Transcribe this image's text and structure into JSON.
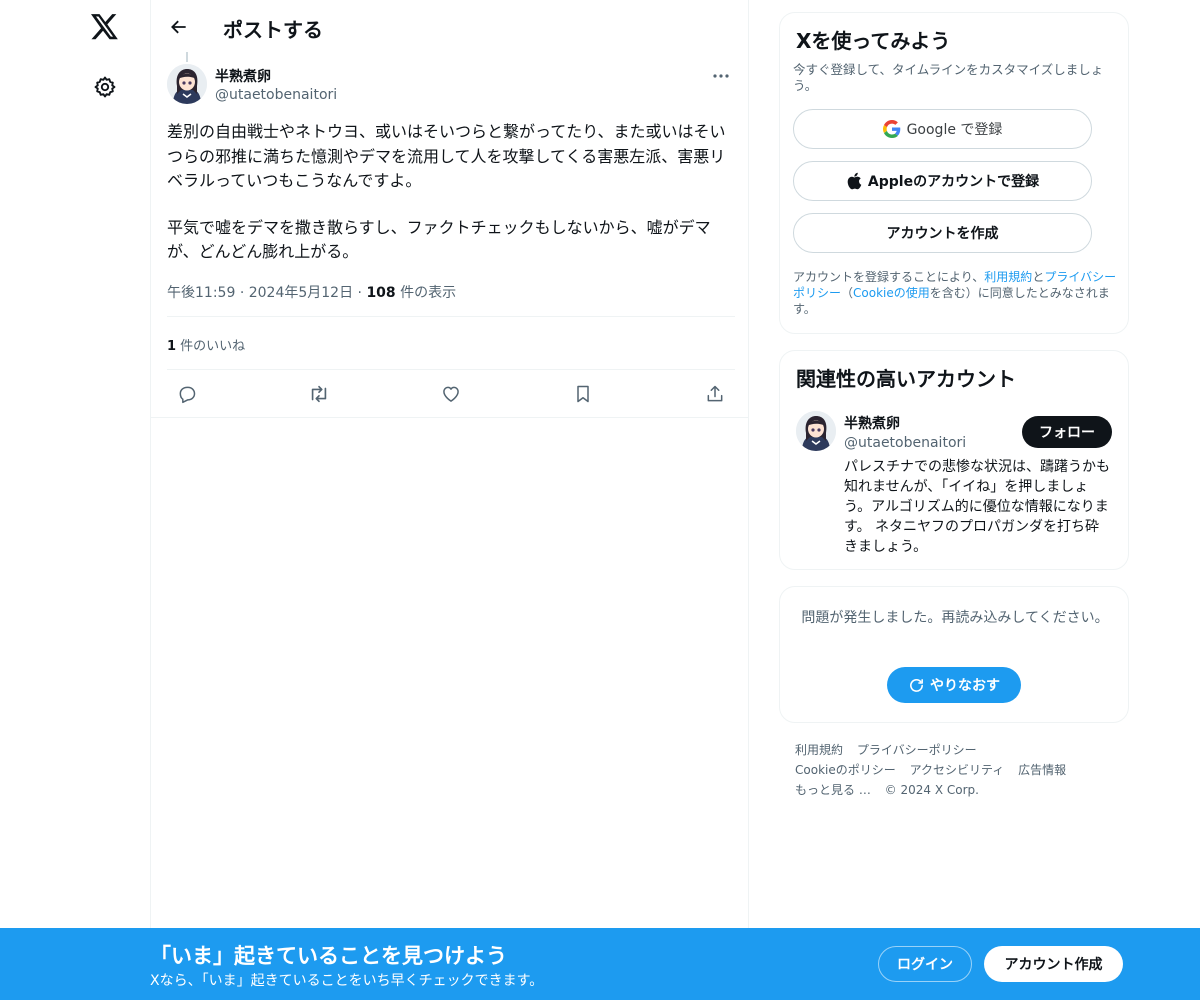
{
  "nav": {
    "logo_icon": "x-logo-icon",
    "settings_icon": "gear-icon"
  },
  "header": {
    "back_icon": "arrow-left-icon",
    "title": "ポストする"
  },
  "post": {
    "author_name": "半熟煮卵",
    "author_handle": "@utaetobenaitori",
    "paragraph1": "差別の自由戦士やネトウヨ、或いはそいつらと繋がってたり、また或いはそいつらの邪推に満ちた憶測やデマを流用して人を攻撃してくる害悪左派、害悪リベラルっていつもこうなんですよ。",
    "paragraph2": "平気で嘘をデマを撒き散らすし、ファクトチェックもしないから、嘘がデマが、どんどん膨れ上がる。",
    "time": "午後11:59",
    "sep": "·",
    "date": "2024年5月12日",
    "views_count": "108",
    "views_label": " 件の表示",
    "likes_count": "1",
    "likes_label": " 件のいいね"
  },
  "signup": {
    "title": "Xを使ってみよう",
    "subtitle": "今すぐ登録して、タイムラインをカスタマイズしましょう。",
    "google_label": "Google で登録",
    "apple_label": "Appleのアカウントで登録",
    "create_label": "アカウントを作成",
    "terms_prefix": "アカウントを登録することにより、",
    "terms_link": "利用規約",
    "terms_and": "と",
    "privacy_link": "プライバシーポリシー",
    "terms_paren_open": "（",
    "cookie_link": "Cookieの使用",
    "terms_suffix": "を含む）に同意したとみなされます。"
  },
  "related": {
    "title": "関連性の高いアカウント",
    "name": "半熟煮卵",
    "handle": "@utaetobenaitori",
    "follow_label": "フォロー",
    "bio": "パレスチナでの悲惨な状況は、躊躇うかも知れませんが、「イイね」を押しましょう。アルゴリズム的に優位な情報になります。 ネタニヤフのプロパガンダを打ち砕きましょう。"
  },
  "error": {
    "message": "問題が発生しました。再読み込みしてください。",
    "retry_label": "やりなおす"
  },
  "footer": {
    "terms": "利用規約",
    "privacy": "プライバシーポリシー",
    "cookie": "Cookieのポリシー",
    "accessibility": "アクセシビリティ",
    "ads": "広告情報",
    "more": "もっと見る …",
    "copyright": "© 2024 X Corp."
  },
  "banner": {
    "title": "「いま」起きていることを見つけよう",
    "subtitle": "Xなら、「いま」起きていることをいち早くチェックできます。",
    "login_label": "ログイン",
    "create_label": "アカウント作成"
  },
  "colors": {
    "accent": "#1d9bf0",
    "text": "#0f1419",
    "muted": "#536471",
    "border": "#eff3f4"
  }
}
